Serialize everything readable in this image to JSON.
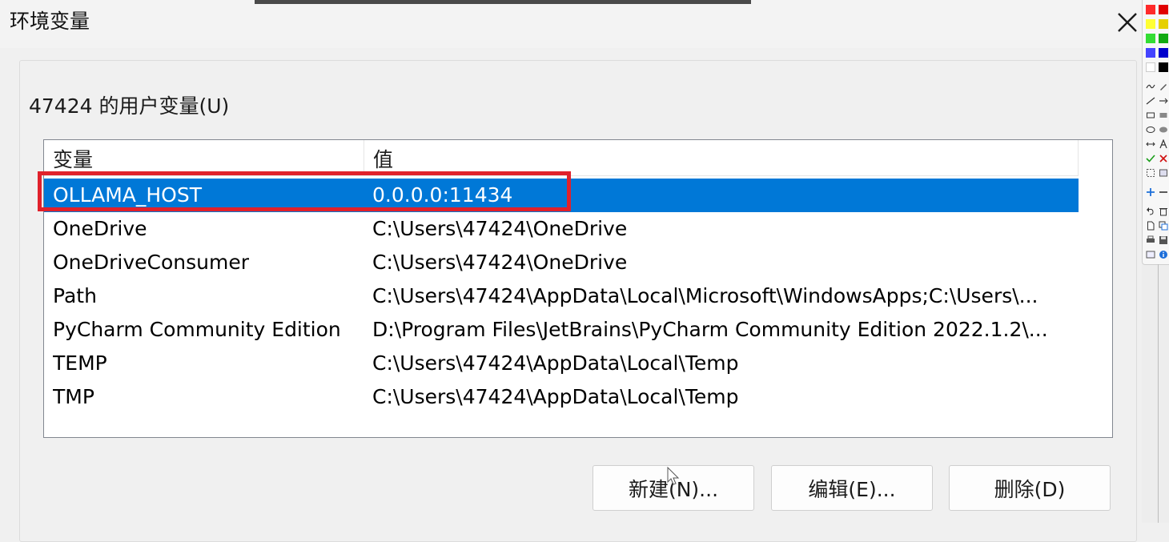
{
  "window": {
    "title": "环境变量"
  },
  "user_group": {
    "label": "47424 的用户变量(U)",
    "columns": {
      "name": "变量",
      "value": "值"
    },
    "rows": [
      {
        "name": "OLLAMA_HOST",
        "value": "0.0.0.0:11434",
        "selected": true
      },
      {
        "name": "OneDrive",
        "value": "C:\\Users\\47424\\OneDrive"
      },
      {
        "name": "OneDriveConsumer",
        "value": "C:\\Users\\47424\\OneDrive"
      },
      {
        "name": "Path",
        "value": "C:\\Users\\47424\\AppData\\Local\\Microsoft\\WindowsApps;C:\\Users\\..."
      },
      {
        "name": "PyCharm Community Edition",
        "value": "D:\\Program Files\\JetBrains\\PyCharm Community Edition 2022.1.2\\..."
      },
      {
        "name": "TEMP",
        "value": "C:\\Users\\47424\\AppData\\Local\\Temp"
      },
      {
        "name": "TMP",
        "value": "C:\\Users\\47424\\AppData\\Local\\Temp"
      }
    ],
    "buttons": {
      "new": "新建(N)...",
      "edit": "编辑(E)...",
      "delete": "删除(D)"
    }
  },
  "colors": {
    "selection": "#0078d7",
    "highlight_border": "#e0212b"
  },
  "icons": {
    "close": "close-icon",
    "cursor": "mouse-cursor-icon"
  }
}
